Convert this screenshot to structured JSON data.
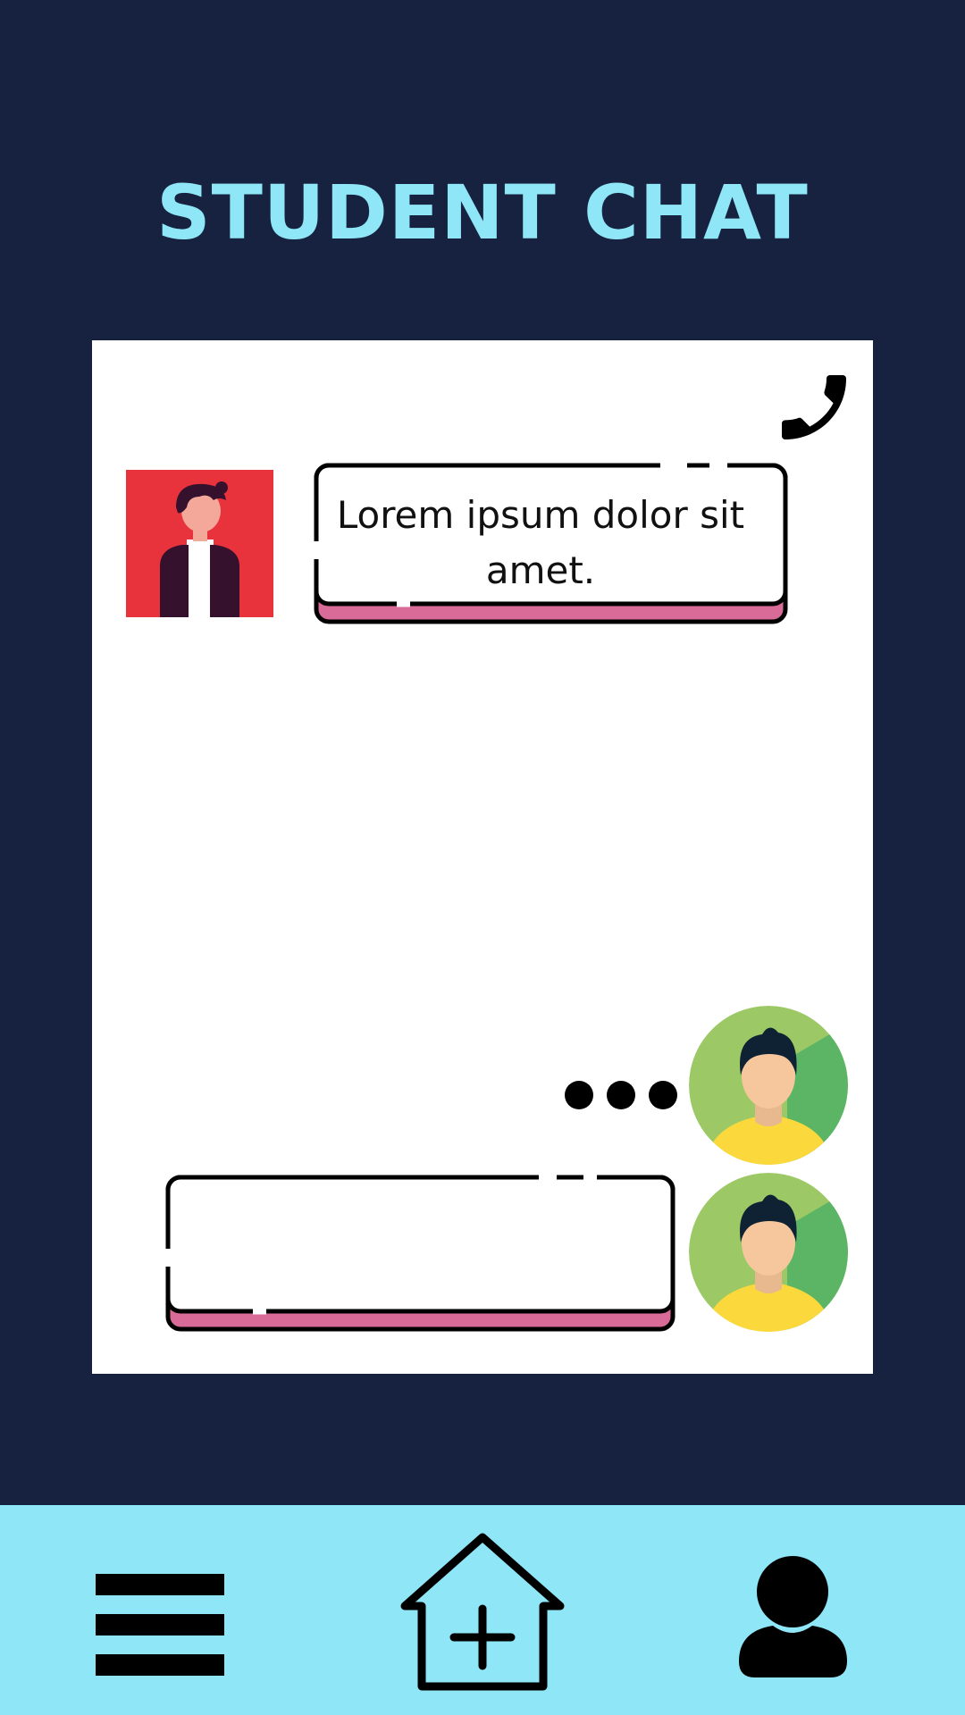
{
  "header": {
    "title": "STUDENT CHAT"
  },
  "chat": {
    "messages": [
      {
        "sender": "contact",
        "text": "Lorem ipsum dolor sit amet."
      }
    ],
    "typing_indicator": "typing-dots-icon",
    "input": {
      "value": ""
    }
  },
  "icons": {
    "call": "phone-icon",
    "menu": "hamburger-menu-icon",
    "home": "home-add-icon",
    "profile": "user-profile-icon"
  },
  "colors": {
    "background": "#16223f",
    "title": "#8fe6f6",
    "panel": "#ffffff",
    "nav_bar": "#8fe6f6",
    "bubble_accent": "#d96b98",
    "avatar_red": "#e8333c",
    "avatar_green": "#9cc965"
  }
}
